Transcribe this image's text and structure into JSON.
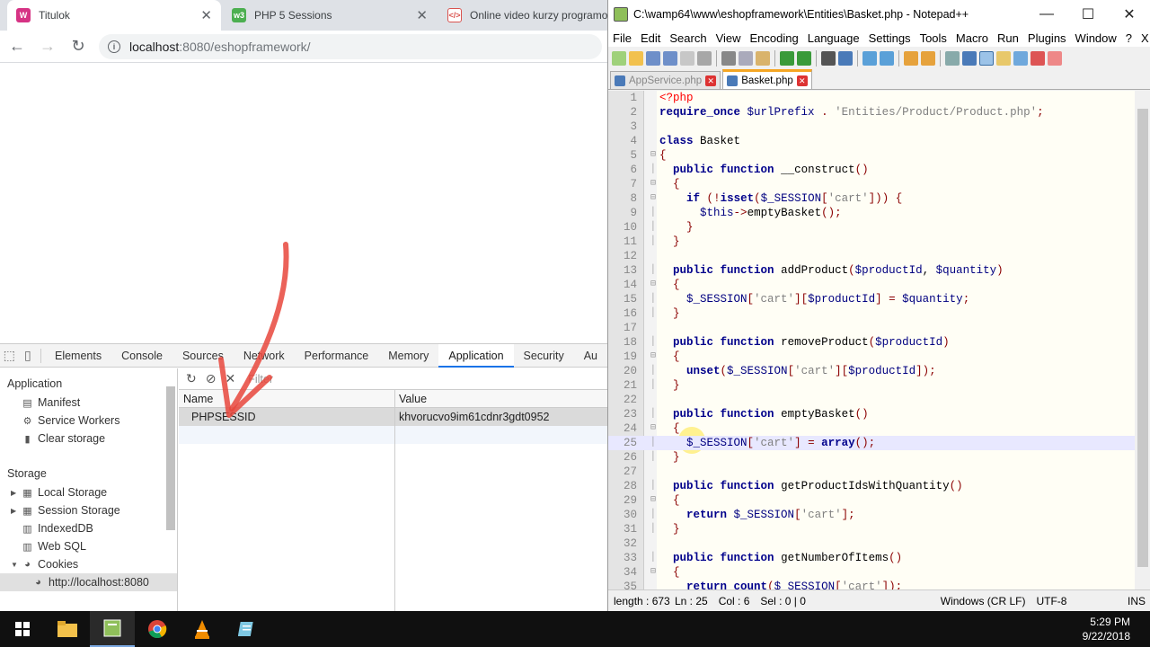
{
  "chrome": {
    "tabs": [
      {
        "title": "Titulok",
        "active": true
      },
      {
        "title": "PHP 5 Sessions",
        "active": false
      },
      {
        "title": "Online video kurzy programo",
        "active": false
      }
    ],
    "url_host": "localhost",
    "url_rest": ":8080/eshopframework/"
  },
  "devtools": {
    "tabs": [
      "Elements",
      "Console",
      "Sources",
      "Network",
      "Performance",
      "Memory",
      "Application",
      "Security",
      "Au"
    ],
    "active_tab": "Application",
    "sidebar": {
      "application_label": "Application",
      "application_items": [
        "Manifest",
        "Service Workers",
        "Clear storage"
      ],
      "storage_label": "Storage",
      "storage_items": [
        "Local Storage",
        "Session Storage",
        "IndexedDB",
        "Web SQL",
        "Cookies",
        "http://localhost:8080"
      ]
    },
    "filter_placeholder": "Filter",
    "columns": [
      "Name",
      "Value"
    ],
    "rows": [
      {
        "name": "PHPSESSID",
        "value": "khvorucvo9im61cdnr3gdt0952"
      }
    ]
  },
  "npp": {
    "title": "C:\\wamp64\\www\\eshopframework\\Entities\\Basket.php - Notepad++",
    "menu": [
      "File",
      "Edit",
      "Search",
      "View",
      "Encoding",
      "Language",
      "Settings",
      "Tools",
      "Macro",
      "Run",
      "Plugins",
      "Window",
      "?"
    ],
    "menu_close": "X",
    "tabs": [
      "AppService.php",
      "Basket.php"
    ],
    "active_tab": "Basket.php",
    "status": {
      "length": "length : 673",
      "ln": "Ln : 25",
      "col": "Col : 6",
      "sel": "Sel : 0 | 0",
      "eol": "Windows (CR LF)",
      "enc": "UTF-8",
      "mode": "INS"
    },
    "current_line": 25,
    "lines": [
      "<?php",
      "require_once $urlPrefix . 'Entities/Product/Product.php';",
      "",
      "class Basket",
      "{",
      "  public function __construct()",
      "  {",
      "    if (!isset($_SESSION['cart'])) {",
      "      $this->emptyBasket();",
      "    }",
      "  }",
      "",
      "  public function addProduct($productId, $quantity)",
      "  {",
      "    $_SESSION['cart'][$productId] = $quantity;",
      "  }",
      "",
      "  public function removeProduct($productId)",
      "  {",
      "    unset($_SESSION['cart'][$productId]);",
      "  }",
      "",
      "  public function emptyBasket()",
      "  {",
      "    $_SESSION['cart'] = array();",
      "  }",
      "",
      "  public function getProductIdsWithQuantity()",
      "  {",
      "    return $_SESSION['cart'];",
      "  }",
      "",
      "  public function getNumberOfItems()",
      "  {",
      "    return count($_SESSION['cart']);"
    ]
  },
  "taskbar": {
    "time": "5:29 PM",
    "date": "9/22/2018"
  }
}
